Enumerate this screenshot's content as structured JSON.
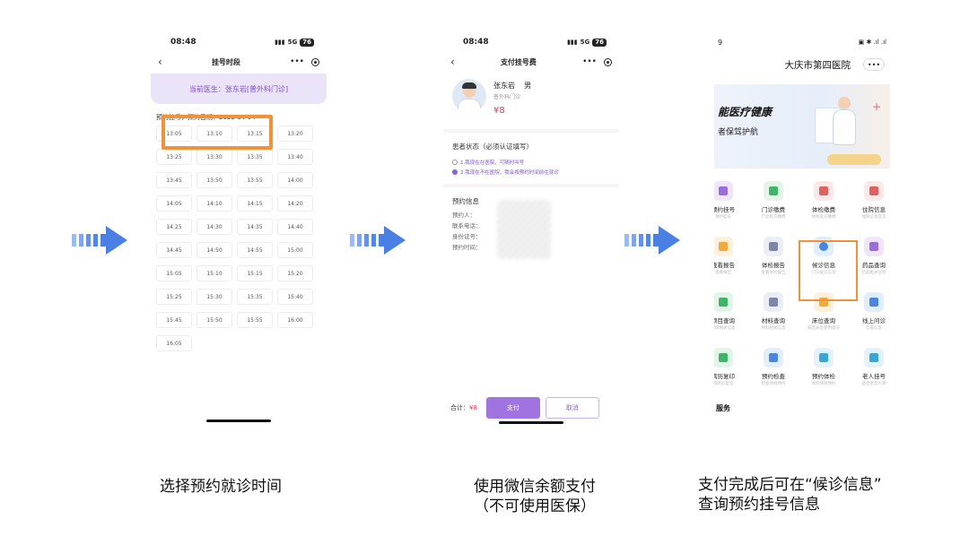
{
  "arrows_color": "#4a7fe4",
  "highlight_color": "#f0923a",
  "accent_color": "#a074e0",
  "phone1": {
    "time": "08:48",
    "signal": "5G",
    "battery": "76",
    "title": "挂号时段",
    "doctor_banner": "当前医生：张东岩[普外科门诊]",
    "date_line": "预约挂号，预约日期：2023-04-04",
    "slots": [
      "13:05",
      "13:10",
      "13:15",
      "13:20",
      "13:25",
      "13:30",
      "13:35",
      "13:40",
      "13:45",
      "13:50",
      "13:55",
      "14:00",
      "14:05",
      "14:10",
      "14:15",
      "14:20",
      "14:25",
      "14:30",
      "14:35",
      "14:40",
      "14:45",
      "14:50",
      "14:55",
      "15:00",
      "15:05",
      "15:10",
      "15:15",
      "15:20",
      "15:25",
      "15:30",
      "15:35",
      "15:40",
      "15:45",
      "15:50",
      "15:55",
      "16:00",
      "16:05"
    ]
  },
  "phone2": {
    "time": "08:48",
    "signal": "5G",
    "battery": "76",
    "title": "支付挂号费",
    "doctor_name": "张东岩",
    "doctor_gender": "男",
    "doctor_dept": "普外科门诊",
    "price": "¥8",
    "status_title": "患者状态（必须认证填写）",
    "option1": "1.我现在在医院，可随时叫号",
    "option2": "2.我现在不在医院，我会按预约时间前往就诊",
    "info_title": "预约信息",
    "info_rows": [
      "预约人：",
      "联系电话：",
      "身份证号：",
      "预约时间："
    ],
    "total_label": "合计：",
    "total_value": "¥8",
    "pay_label": "支付",
    "cancel_label": "取消"
  },
  "phone3": {
    "time": "9",
    "hospital": "大庆市第四医院",
    "menu_dots": "•••",
    "banner_line1": "能医疗健康",
    "banner_line2": "者保驾护航",
    "tiles": [
      {
        "title": "预约挂号",
        "sub": "预约挂号",
        "bg": "#efe6fb",
        "fg": "#9b6cdc"
      },
      {
        "title": "门诊缴费",
        "sub": "门诊处方缴费",
        "bg": "#e3f5e8",
        "fg": "#3fb56a"
      },
      {
        "title": "体检缴费",
        "sub": "体检处方缴费",
        "bg": "#fde8e8",
        "fg": "#e06060"
      },
      {
        "title": "住院信息",
        "sub": "住院信息及交",
        "bg": "#fde8e8",
        "fg": "#e06060"
      },
      {
        "title": "查看报告",
        "sub": "查看报告",
        "bg": "#fdf1dc",
        "fg": "#f0a93a"
      },
      {
        "title": "体检报告",
        "sub": "查看体检报告",
        "bg": "#eceef5",
        "fg": "#7d86a8"
      },
      {
        "title": "候诊信息",
        "sub": "门诊候诊信息",
        "bg": "#e3eefc",
        "fg": "#4a86e0"
      },
      {
        "title": "药品查询",
        "sub": "药品相关信息",
        "bg": "#efe6fb",
        "fg": "#9b6cdc"
      },
      {
        "title": "项目查询",
        "sub": "项目相关信息",
        "bg": "#e3f5e8",
        "fg": "#3fb56a"
      },
      {
        "title": "材料查询",
        "sub": "材料相关信息",
        "bg": "#eceef5",
        "fg": "#7d86a8"
      },
      {
        "title": "床位查询",
        "sub": "病区床位使用情况",
        "bg": "#fdf1dc",
        "fg": "#f0a93a"
      },
      {
        "title": "线上问诊",
        "sub": "诊查信息",
        "bg": "#e3eefc",
        "fg": "#4a86e0"
      },
      {
        "title": "病历复印",
        "sub": "病病历复印",
        "bg": "#e3f5e8",
        "fg": "#3fb56a"
      },
      {
        "title": "预约检查",
        "sub": "检查项目预约",
        "bg": "#e3eefc",
        "fg": "#4a86e0"
      },
      {
        "title": "预约体检",
        "sub": "体检项目预约",
        "bg": "#e3f2fb",
        "fg": "#3aa6d8"
      },
      {
        "title": "老人挂号",
        "sub": "适合老年人预",
        "bg": "#e3f2fb",
        "fg": "#3aa6d8"
      }
    ],
    "services_label": "服务"
  },
  "captions": {
    "c1": "选择预约就诊时间",
    "c2_line1": "使用微信余额支付",
    "c2_line2": "（不可使用医保）",
    "c3_line1": "支付完成后可在“候诊信息”",
    "c3_line2": "查询预约挂号信息"
  }
}
